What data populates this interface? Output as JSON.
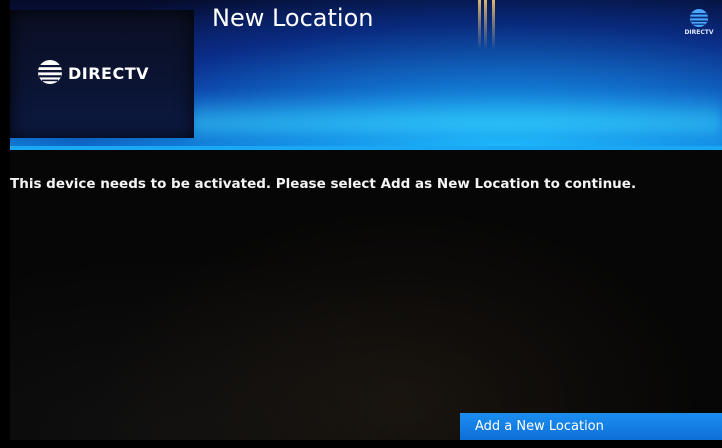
{
  "header": {
    "title": "New Location",
    "brand_logo_text": "DIRECTV",
    "corner_logo_text": "DIRECTV",
    "accent_color": "#1aa8f5"
  },
  "main": {
    "message": "This device needs to be activated. Please select Add as New Location to continue."
  },
  "actions": {
    "add_location_label": "Add a New Location"
  },
  "icons": {
    "brand": "globe-icon",
    "corner": "globe-icon"
  }
}
